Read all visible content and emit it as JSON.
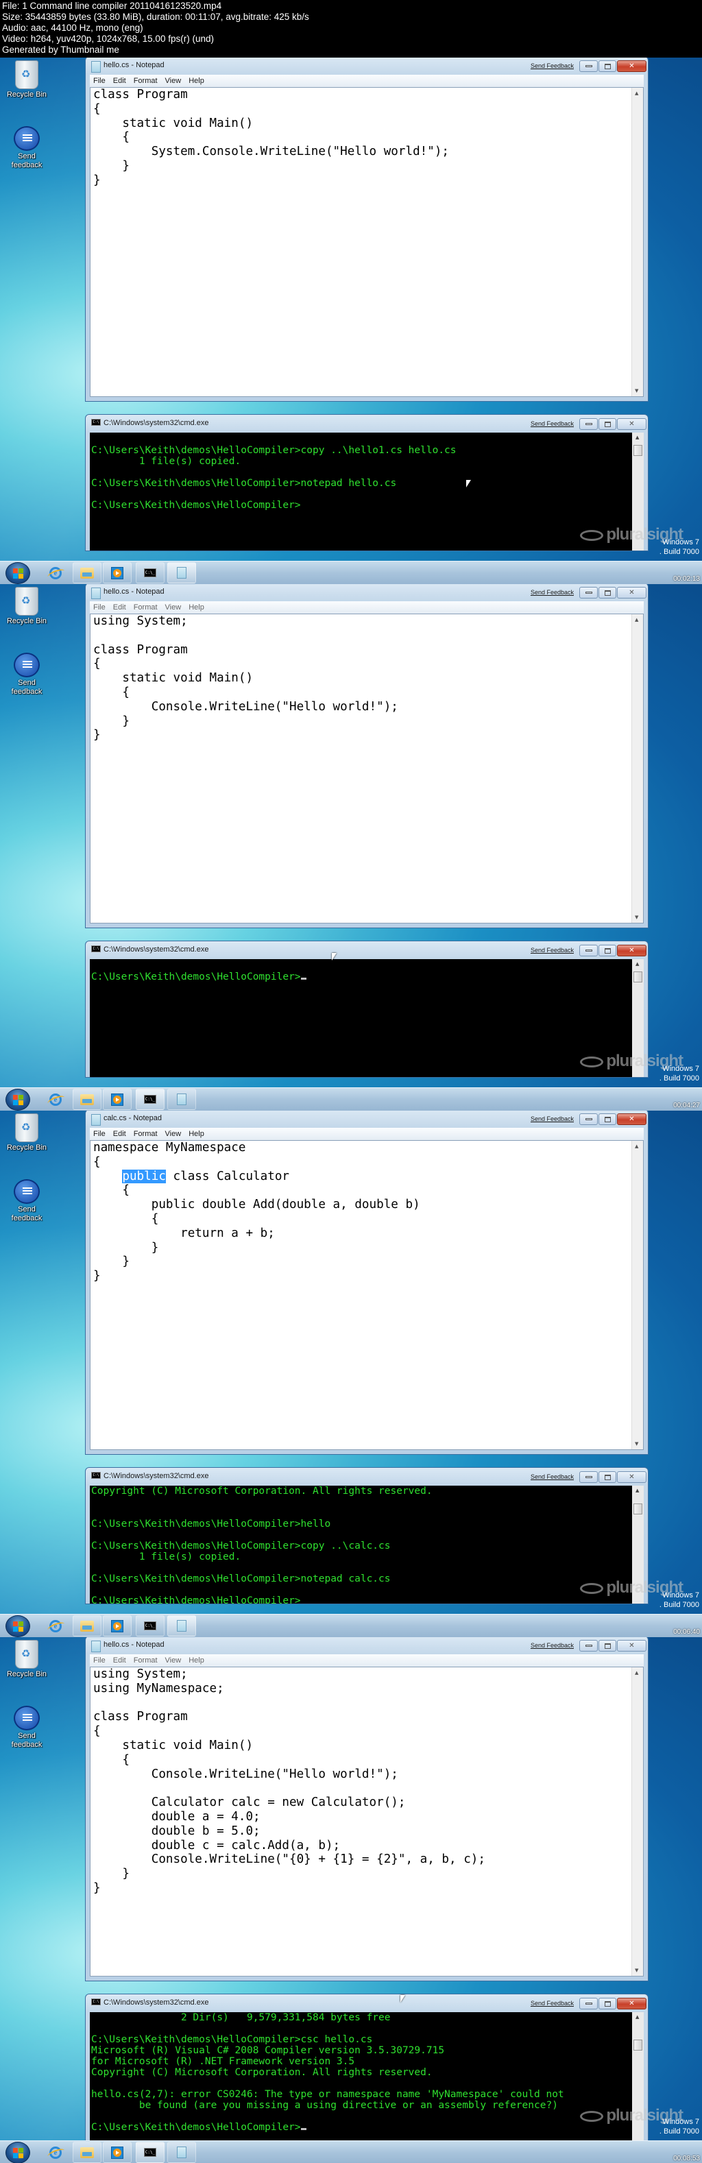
{
  "header": {
    "lines": [
      "File: 1 Command line compiler 20110416123520.mp4",
      "Size: 35443859 bytes (33.80 MiB), duration: 00:11:07, avg.bitrate: 425 kb/s",
      "Audio: aac, 44100 Hz, mono (eng)",
      "Video: h264, yuv420p, 1024x768, 15.00 fps(r) (und)",
      "Generated by Thumbnail me"
    ]
  },
  "desktop": {
    "icons": [
      {
        "label": "Recycle Bin",
        "icon": "recycle-bin-icon"
      },
      {
        "label": "Send feedback",
        "icon": "send-feedback-icon"
      }
    ],
    "watermark": "pluralsight",
    "os_version": [
      "Windows 7",
      ". Build 7000"
    ]
  },
  "taskbar": {
    "items": [
      "start-orb",
      "internet-explorer-icon",
      "windows-explorer-icon",
      "media-player-icon",
      "command-prompt-icon",
      "notepad-icon"
    ]
  },
  "common": {
    "send_feedback": "Send Feedback",
    "menu": [
      "File",
      "Edit",
      "Format",
      "View",
      "Help"
    ],
    "cmd_title": "C:\\Windows\\system32\\cmd.exe"
  },
  "frames": [
    {
      "timestamp": "00:02:13",
      "notepad_title": "hello.cs - Notepad",
      "code": [
        "class Program",
        "{",
        "    static void Main()",
        "    {",
        "        System.Console.WriteLine(\"Hello world!\");",
        "    }",
        "}"
      ],
      "console": [
        "",
        "C:\\Users\\Keith\\demos\\HelloCompiler>copy ..\\hello1.cs hello.cs",
        "        1 file(s) copied.",
        "",
        "C:\\Users\\Keith\\demos\\HelloCompiler>notepad hello.cs",
        "",
        "C:\\Users\\Keith\\demos\\HelloCompiler>"
      ]
    },
    {
      "timestamp": "00:04:27",
      "notepad_title": "hello.cs - Notepad",
      "code": [
        "using System;",
        "",
        "class Program",
        "{",
        "    static void Main()",
        "    {",
        "        Console.WriteLine(\"Hello world!\");",
        "    }",
        "}"
      ],
      "console": [
        "",
        "C:\\Users\\Keith\\demos\\HelloCompiler>"
      ]
    },
    {
      "timestamp": "00:06:40",
      "notepad_title": "calc.cs - Notepad",
      "code_pre": "namespace MyNamespace\n{\n    ",
      "code_sel": "public",
      "code_post": " class Calculator\n    {\n        public double Add(double a, double b)\n        {\n            return a + b;\n        }\n    }\n}",
      "console": [
        "Copyright (C) Microsoft Corporation. All rights reserved.",
        "",
        "",
        "C:\\Users\\Keith\\demos\\HelloCompiler>hello",
        "",
        "C:\\Users\\Keith\\demos\\HelloCompiler>copy ..\\calc.cs",
        "        1 file(s) copied.",
        "",
        "C:\\Users\\Keith\\demos\\HelloCompiler>notepad calc.cs",
        "",
        "C:\\Users\\Keith\\demos\\HelloCompiler>"
      ]
    },
    {
      "timestamp": "00:08:53",
      "notepad_title": "hello.cs - Notepad",
      "code": [
        "using System;",
        "using MyNamespace;",
        "",
        "class Program",
        "{",
        "    static void Main()",
        "    {",
        "        Console.WriteLine(\"Hello world!\");",
        "",
        "        Calculator calc = new Calculator();",
        "        double a = 4.0;",
        "        double b = 5.0;",
        "        double c = calc.Add(a, b);",
        "        Console.WriteLine(\"{0} + {1} = {2}\", a, b, c);",
        "    }",
        "}"
      ],
      "console": [
        "               2 Dir(s)   9,579,331,584 bytes free",
        "",
        "C:\\Users\\Keith\\demos\\HelloCompiler>csc hello.cs",
        "Microsoft (R) Visual C# 2008 Compiler version 3.5.30729.715",
        "for Microsoft (R) .NET Framework version 3.5",
        "Copyright (C) Microsoft Corporation. All rights reserved.",
        "",
        "hello.cs(2,7): error CS0246: The type or namespace name 'MyNamespace' could not",
        "        be found (are you missing a using directive or an assembly reference?)",
        "",
        "C:\\Users\\Keith\\demos\\HelloCompiler>"
      ]
    }
  ]
}
